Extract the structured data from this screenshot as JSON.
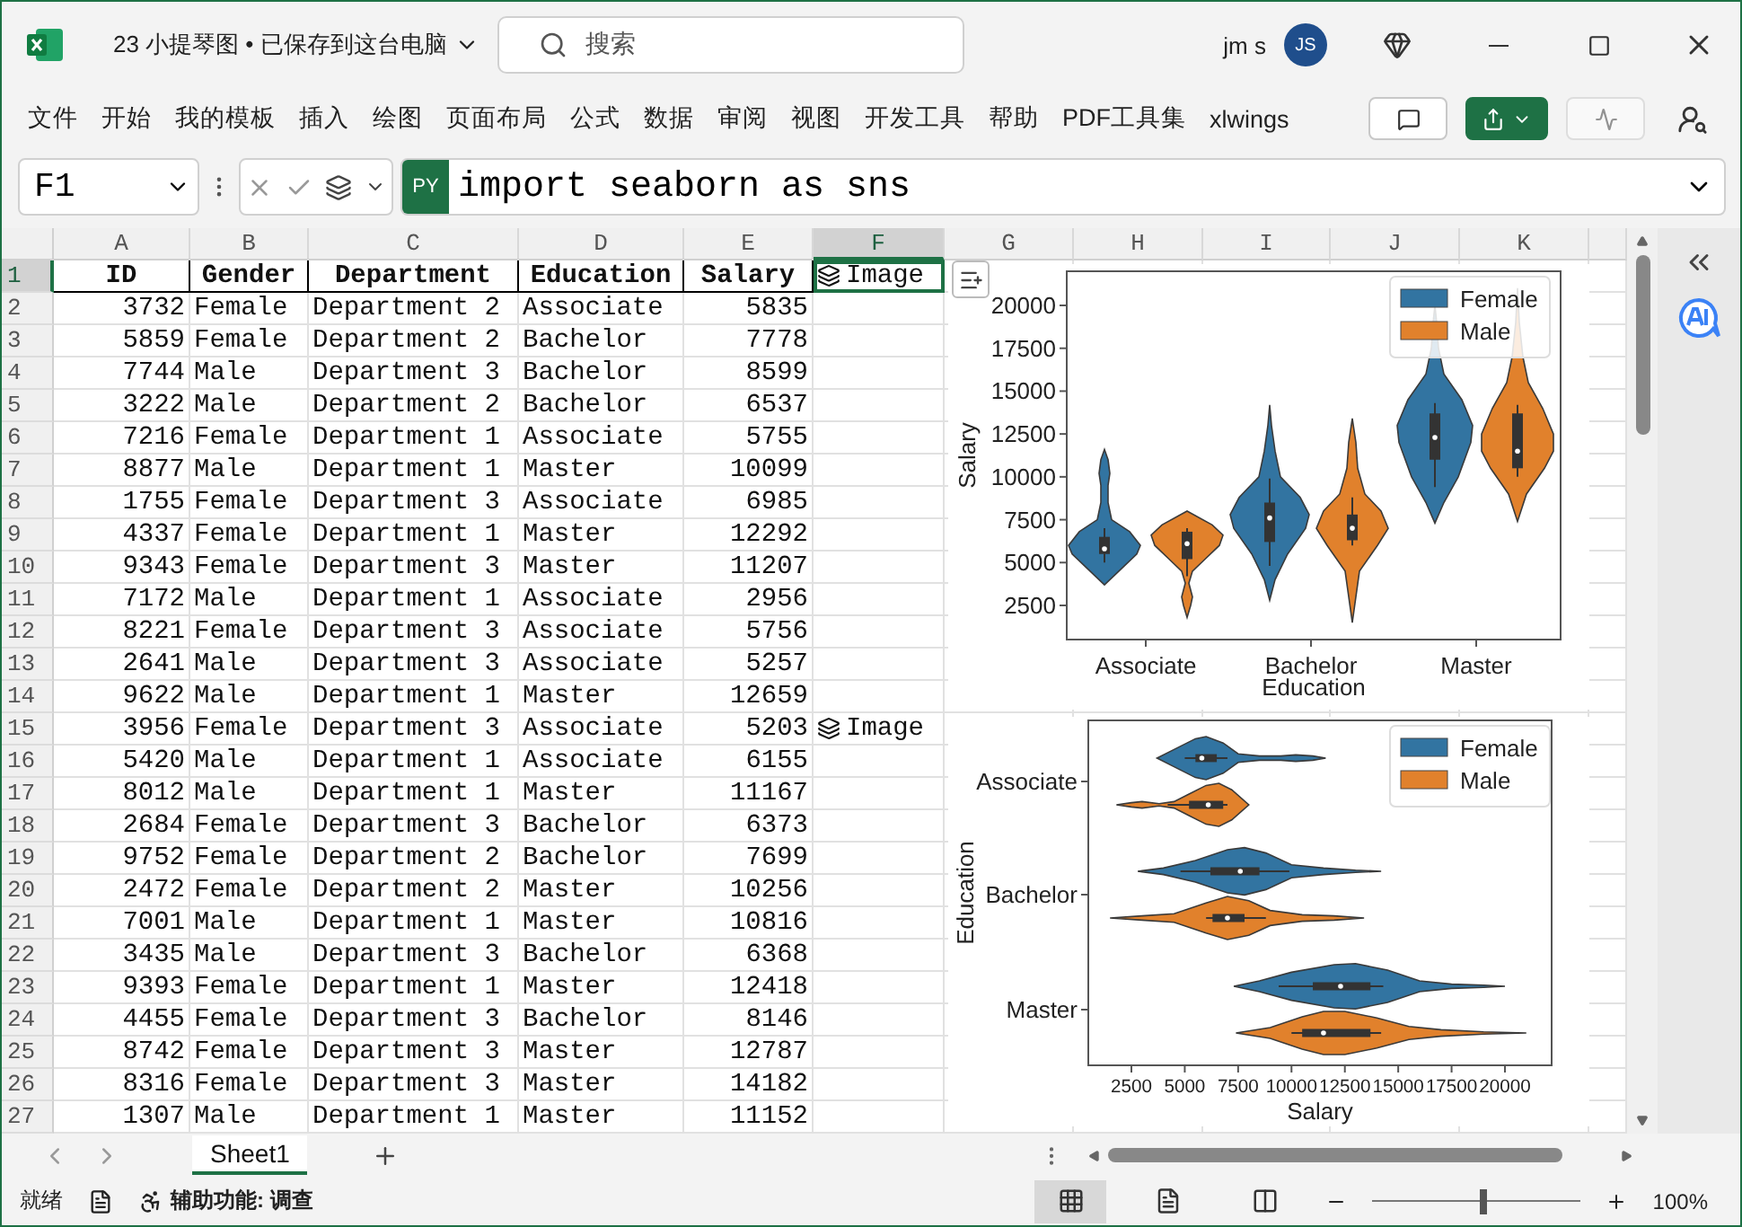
{
  "title_bar": {
    "title": "23 小提琴图 • 已保存到这台电脑",
    "search_placeholder": "搜索",
    "user_name": "jm s",
    "avatar_initials": "JS"
  },
  "menu": [
    "文件",
    "开始",
    "我的模板",
    "插入",
    "绘图",
    "页面布局",
    "公式",
    "数据",
    "审阅",
    "视图",
    "开发工具",
    "帮助",
    "PDF工具集",
    "xlwings"
  ],
  "formula_bar": {
    "name_box": "F1",
    "badge": "PY",
    "formula": "import seaborn as sns"
  },
  "columns": [
    {
      "label": "A",
      "selected": false
    },
    {
      "label": "B",
      "selected": false
    },
    {
      "label": "C",
      "selected": false
    },
    {
      "label": "D",
      "selected": false
    },
    {
      "label": "E",
      "selected": false
    },
    {
      "label": "F",
      "selected": true
    },
    {
      "label": "G",
      "selected": false
    },
    {
      "label": "H",
      "selected": false
    },
    {
      "label": "I",
      "selected": false
    },
    {
      "label": "J",
      "selected": false
    },
    {
      "label": "K",
      "selected": false
    }
  ],
  "rows": [
    {
      "number": "1",
      "kind": "header",
      "selected": true,
      "id": "ID",
      "gender": "Gender",
      "department": "Department",
      "education": "Education",
      "salary": "Salary",
      "image": "Image"
    },
    {
      "number": "2",
      "kind": "data",
      "selected": false,
      "id": "3732",
      "gender": "Female",
      "department": "Department 2",
      "education": "Associate",
      "salary": "5835"
    },
    {
      "number": "3",
      "kind": "data",
      "selected": false,
      "id": "5859",
      "gender": "Female",
      "department": "Department 2",
      "education": "Bachelor",
      "salary": "7778"
    },
    {
      "number": "4",
      "kind": "data",
      "selected": false,
      "id": "7744",
      "gender": "Male",
      "department": "Department 3",
      "education": "Bachelor",
      "salary": "8599"
    },
    {
      "number": "5",
      "kind": "data",
      "selected": false,
      "id": "3222",
      "gender": "Male",
      "department": "Department 2",
      "education": "Bachelor",
      "salary": "6537"
    },
    {
      "number": "6",
      "kind": "data",
      "selected": false,
      "id": "7216",
      "gender": "Female",
      "department": "Department 1",
      "education": "Associate",
      "salary": "5755"
    },
    {
      "number": "7",
      "kind": "data",
      "selected": false,
      "id": "8877",
      "gender": "Male",
      "department": "Department 1",
      "education": "Master",
      "salary": "10099"
    },
    {
      "number": "8",
      "kind": "data",
      "selected": false,
      "id": "1755",
      "gender": "Female",
      "department": "Department 3",
      "education": "Associate",
      "salary": "6985"
    },
    {
      "number": "9",
      "kind": "data",
      "selected": false,
      "id": "4337",
      "gender": "Female",
      "department": "Department 1",
      "education": "Master",
      "salary": "12292"
    },
    {
      "number": "10",
      "kind": "data",
      "selected": false,
      "id": "9343",
      "gender": "Female",
      "department": "Department 3",
      "education": "Master",
      "salary": "11207"
    },
    {
      "number": "11",
      "kind": "data",
      "selected": false,
      "id": "7172",
      "gender": "Male",
      "department": "Department 1",
      "education": "Associate",
      "salary": "2956"
    },
    {
      "number": "12",
      "kind": "data",
      "selected": false,
      "id": "8221",
      "gender": "Female",
      "department": "Department 3",
      "education": "Associate",
      "salary": "5756"
    },
    {
      "number": "13",
      "kind": "data",
      "selected": false,
      "id": "2641",
      "gender": "Male",
      "department": "Department 3",
      "education": "Associate",
      "salary": "5257"
    },
    {
      "number": "14",
      "kind": "data",
      "selected": false,
      "id": "9622",
      "gender": "Male",
      "department": "Department 1",
      "education": "Master",
      "salary": "12659"
    },
    {
      "number": "15",
      "kind": "data",
      "selected": false,
      "id": "3956",
      "gender": "Female",
      "department": "Department 3",
      "education": "Associate",
      "salary": "5203",
      "image": "Image"
    },
    {
      "number": "16",
      "kind": "data",
      "selected": false,
      "id": "5420",
      "gender": "Male",
      "department": "Department 1",
      "education": "Associate",
      "salary": "6155"
    },
    {
      "number": "17",
      "kind": "data",
      "selected": false,
      "id": "8012",
      "gender": "Male",
      "department": "Department 1",
      "education": "Master",
      "salary": "11167"
    },
    {
      "number": "18",
      "kind": "data",
      "selected": false,
      "id": "2684",
      "gender": "Female",
      "department": "Department 3",
      "education": "Bachelor",
      "salary": "6373"
    },
    {
      "number": "19",
      "kind": "data",
      "selected": false,
      "id": "9752",
      "gender": "Female",
      "department": "Department 2",
      "education": "Bachelor",
      "salary": "7699"
    },
    {
      "number": "20",
      "kind": "data",
      "selected": false,
      "id": "2472",
      "gender": "Female",
      "department": "Department 2",
      "education": "Master",
      "salary": "10256"
    },
    {
      "number": "21",
      "kind": "data",
      "selected": false,
      "id": "7001",
      "gender": "Male",
      "department": "Department 1",
      "education": "Master",
      "salary": "10816"
    },
    {
      "number": "22",
      "kind": "data",
      "selected": false,
      "id": "3435",
      "gender": "Male",
      "department": "Department 3",
      "education": "Bachelor",
      "salary": "6368"
    },
    {
      "number": "23",
      "kind": "data",
      "selected": false,
      "id": "9393",
      "gender": "Female",
      "department": "Department 1",
      "education": "Master",
      "salary": "12418"
    },
    {
      "number": "24",
      "kind": "data",
      "selected": false,
      "id": "4455",
      "gender": "Female",
      "department": "Department 3",
      "education": "Bachelor",
      "salary": "8146"
    },
    {
      "number": "25",
      "kind": "data",
      "selected": false,
      "id": "8742",
      "gender": "Female",
      "department": "Department 3",
      "education": "Master",
      "salary": "12787"
    },
    {
      "number": "26",
      "kind": "data",
      "selected": false,
      "id": "8316",
      "gender": "Female",
      "department": "Department 3",
      "education": "Master",
      "salary": "14182"
    },
    {
      "number": "27",
      "kind": "data",
      "selected": false,
      "id": "1307",
      "gender": "Male",
      "department": "Department 1",
      "education": "Master",
      "salary": "11152"
    }
  ],
  "plots": [
    {
      "kind": "vertical",
      "xlabel": "Education",
      "ylabel": "Salary",
      "categories": [
        "Associate",
        "Bachelor",
        "Master"
      ],
      "ticks": [
        "20000",
        "17500",
        "15000",
        "12500",
        "10000",
        "7500",
        "5000",
        "2500"
      ],
      "legend": [
        {
          "label": "Female",
          "color": "#3274a1"
        },
        {
          "label": "Male",
          "color": "#e1812c"
        }
      ]
    },
    {
      "kind": "horizontal",
      "xlabel": "Salary",
      "ylabel": "Education",
      "categories": [
        "Associate",
        "Bachelor",
        "Master"
      ],
      "ticks": [
        "2500",
        "5000",
        "7500",
        "10000",
        "12500",
        "15000",
        "17500",
        "20000"
      ],
      "legend": [
        {
          "label": "Female",
          "color": "#3274a1"
        },
        {
          "label": "Male",
          "color": "#e1812c"
        }
      ]
    }
  ],
  "sheet_tabs": [
    {
      "label": "Sheet1",
      "selected": true
    }
  ],
  "status_bar": {
    "ready": "就绪",
    "accessibility": "辅助功能: 调查",
    "views": [
      {
        "kind": "normal",
        "selected": true
      },
      {
        "kind": "page_layout",
        "selected": false
      },
      {
        "kind": "page_break",
        "selected": false
      }
    ],
    "zoom_level": {
      "level": 0.53
    },
    "zoom": "100%"
  }
}
